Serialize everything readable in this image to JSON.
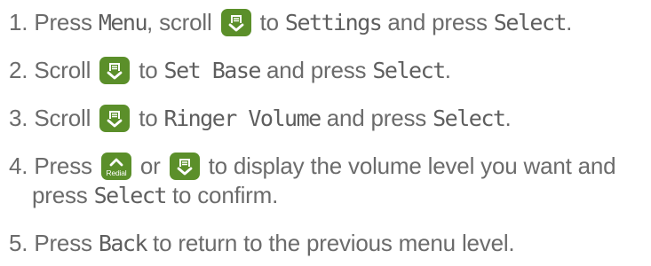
{
  "steps": [
    {
      "number": "1.",
      "t1": "Press ",
      "menu": "Menu",
      "t2": ", scroll ",
      "t3": " to ",
      "settings": "Settings",
      "t4": " and press ",
      "select": "Select",
      "t5": "."
    },
    {
      "number": "2.",
      "t1": "Scroll ",
      "t2": " to ",
      "set_base": "Set Base",
      "t3": " and press ",
      "select": "Select",
      "t4": "."
    },
    {
      "number": "3.",
      "t1": "Scroll ",
      "t2": " to ",
      "ringer_volume": "Ringer Volume",
      "t3": " and press ",
      "select": "Select",
      "t4": "."
    },
    {
      "number": "4.",
      "t1": "Press ",
      "redial_label": "Redial",
      "t2": " or ",
      "t3": " to display the volume level you want and",
      "t4": "press ",
      "select": "Select",
      "t5": " to confirm."
    },
    {
      "number": "5.",
      "t1": "Press ",
      "back": "Back",
      "t2": " to return to the previous menu level."
    }
  ],
  "colors": {
    "body_text": "#6b6b6b",
    "key_fill": "#5b8f2a"
  },
  "icons": {
    "scroll_key": "phonebook-down-key-icon",
    "redial_key": "redial-up-key-icon"
  }
}
